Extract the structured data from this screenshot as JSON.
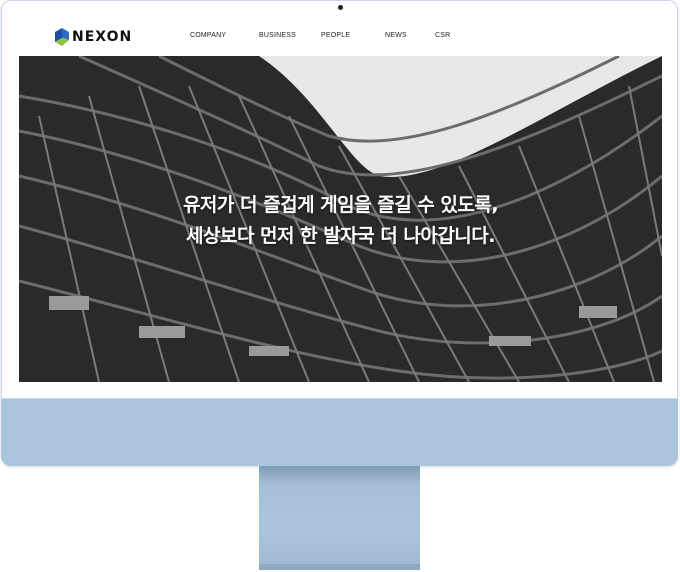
{
  "brand": {
    "name": "NEXON"
  },
  "nav": {
    "items": [
      "COMPANY",
      "BUSINESS",
      "PEOPLE",
      "NEWS",
      "CSR"
    ]
  },
  "hero": {
    "line1": "유저가 더 즐겁게 게임을 즐길 수 있도록,",
    "line2": "세상보다 먼저 한 발자국 더 나아갑니다."
  },
  "colors": {
    "monitor_chin": "#abc6dc",
    "logo_blue": "#1e4fa3",
    "logo_green": "#8bc53f"
  },
  "icons": {
    "logo_mark": "nexon-cube-icon",
    "camera": "camera-dot-icon"
  }
}
